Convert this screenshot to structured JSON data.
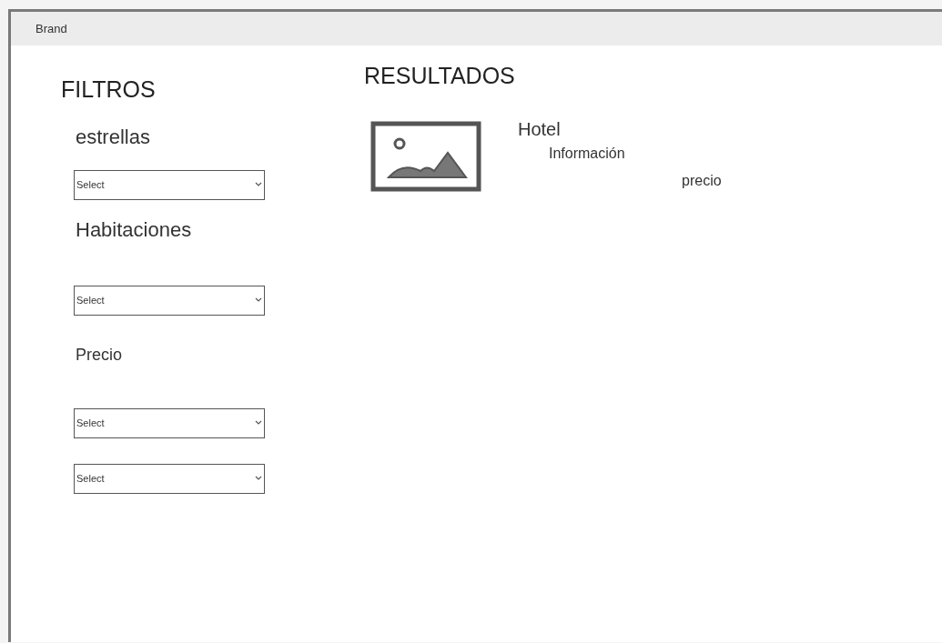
{
  "navbar": {
    "brand": "Brand"
  },
  "filters": {
    "title": "FILTROS",
    "groups": [
      {
        "label": "estrellas",
        "selects": [
          {
            "value": "Select"
          }
        ]
      },
      {
        "label": "Habitaciones",
        "selects": [
          {
            "value": "Select"
          }
        ]
      },
      {
        "label": "Precio",
        "selects": [
          {
            "value": "Select"
          },
          {
            "value": "Select"
          }
        ]
      }
    ]
  },
  "results": {
    "title": "RESULTADOS",
    "items": [
      {
        "name": "Hotel",
        "info": "Información",
        "price": "precio"
      }
    ]
  }
}
